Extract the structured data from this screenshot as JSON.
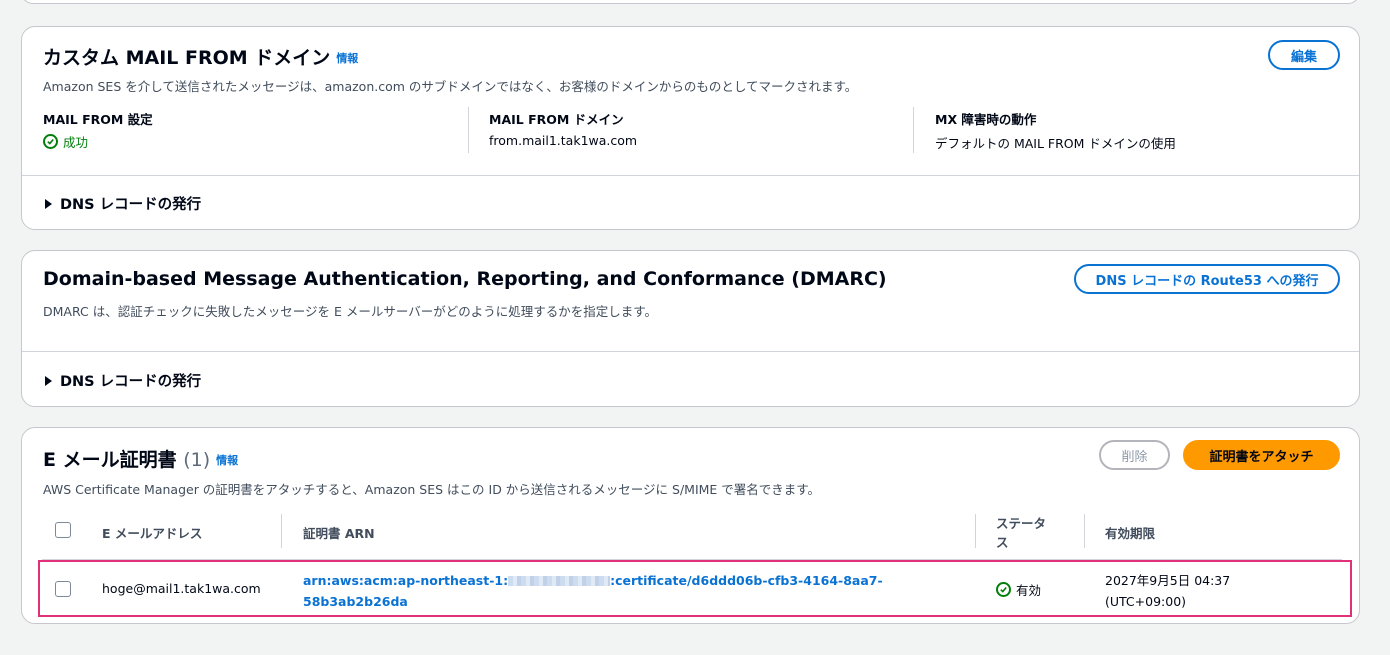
{
  "mail_from": {
    "title": "カスタム MAIL FROM ドメイン",
    "info_label": "情報",
    "edit_button": "編集",
    "description": "Amazon SES を介して送信されたメッセージは、amazon.com のサブドメインではなく、お客様のドメインからのものとしてマークされます。",
    "fields": [
      {
        "label": "MAIL FROM 設定",
        "value": "成功"
      },
      {
        "label": "MAIL FROM ドメイン",
        "value": "from.mail1.tak1wa.com"
      },
      {
        "label": "MX 障害時の動作",
        "value": "デフォルトの MAIL FROM ドメインの使用"
      }
    ],
    "expander": "DNS レコードの発行"
  },
  "dmarc": {
    "title": "Domain-based Message Authentication, Reporting, and Conformance (DMARC)",
    "publish_button": "DNS レコードの Route53 への発行",
    "description": "DMARC は、認証チェックに失敗したメッセージを E メールサーバーがどのように処理するかを指定します。",
    "expander": "DNS レコードの発行"
  },
  "certs": {
    "title": "E メール証明書",
    "count": "(1)",
    "info_label": "情報",
    "delete_button": "削除",
    "attach_button": "証明書をアタッチ",
    "description": "AWS Certificate Manager の証明書をアタッチすると、Amazon SES はこの ID から送信されるメッセージに S/MIME で署名できます。",
    "columns": {
      "email": "E メールアドレス",
      "arn": "証明書 ARN",
      "status_line1": "ステータ",
      "status_line2": "ス",
      "expiry": "有効期限"
    },
    "rows": [
      {
        "email": "hoge@mail1.tak1wa.com",
        "arn_prefix": "arn:aws:acm:ap-northeast-1:",
        "arn_suffix": ":certificate/d6ddd06b-cfb3-4164-8aa7-",
        "arn_line2": "58b3ab2b26da",
        "status": "有効",
        "expiry_line1": "2027年9月5日 04:37",
        "expiry_line2": "(UTC+09:00)"
      }
    ]
  },
  "colors": {
    "link": "#0972d3",
    "success": "#037f0c",
    "primary": "#ff9900",
    "highlight": "#e0307a"
  }
}
